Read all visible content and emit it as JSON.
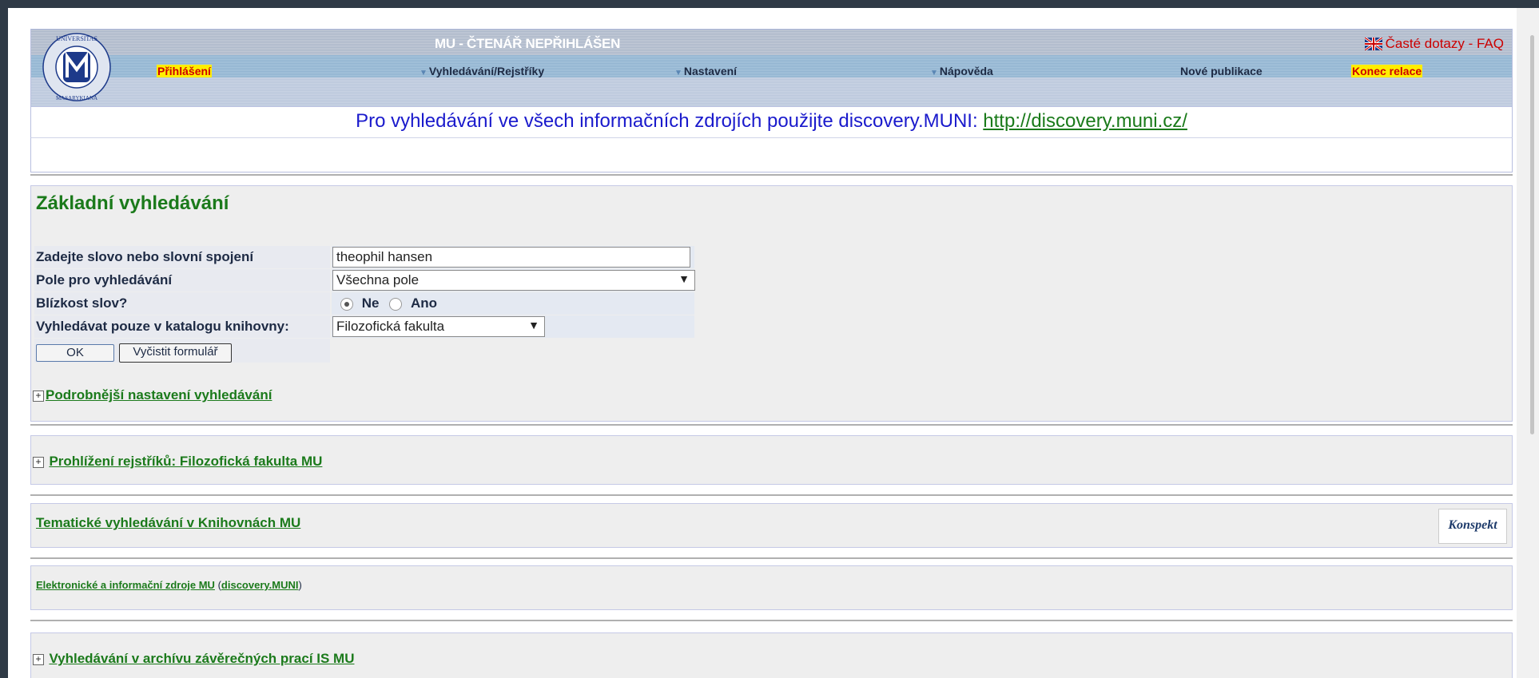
{
  "header": {
    "reader_status": "MU - ČTENÁŘ NEPŘIHLÁŠEN",
    "faq_label": "Časté dotazy - FAQ",
    "logo_text": "UNIVERSITAS MASARYKIANA BRUNENSIS",
    "nav": {
      "login": "Přihlášení",
      "search_indexes": "Vyhledávání/Rejstříky",
      "settings": "Nastavení",
      "help": "Nápověda",
      "new_publications": "Nové publikace",
      "end_session": "Konec relace"
    }
  },
  "banner": {
    "text": "Pro vyhledávání ve všech informačních zdrojích použijte discovery.MUNI:",
    "link": "http://discovery.muni.cz/"
  },
  "basic_search": {
    "title": "Základní vyhledávání",
    "word_label": "Zadejte slovo nebo slovní spojení",
    "word_value": "theophil hansen",
    "field_label": "Pole pro vyhledávání",
    "field_value": "Všechna pole",
    "proximity_label": "Blízkost slov?",
    "proximity_no": "Ne",
    "proximity_yes": "Ano",
    "proximity_selected": "Ne",
    "catalog_label": "Vyhledávat pouze v katalogu knihovny:",
    "catalog_value": "Filozofická fakulta",
    "ok_button": "OK",
    "clear_button": "Vyčistit formulář",
    "advanced_link": "Podrobnější nastavení vyhledávání"
  },
  "browse_panel": {
    "link": "Prohlížení rejstříků: Filozofická fakulta MU"
  },
  "thematic_panel": {
    "link": "Tematické vyhledávání v Knihovnách MU",
    "logo_text": "Konspekt"
  },
  "eresources_panel": {
    "link": "Elektronické a informační zdroje MU",
    "open_paren": "(",
    "link2": "discovery.MUNI",
    "close_paren": ")"
  },
  "archive_panel": {
    "link": "Vyhledávání v archívu závěrečných prací IS MU"
  },
  "colors": {
    "green_link": "#1b7a1b",
    "banner_blue": "#1a1acc",
    "highlight_yellow": "#ffee00",
    "highlight_red": "#cc0000"
  }
}
